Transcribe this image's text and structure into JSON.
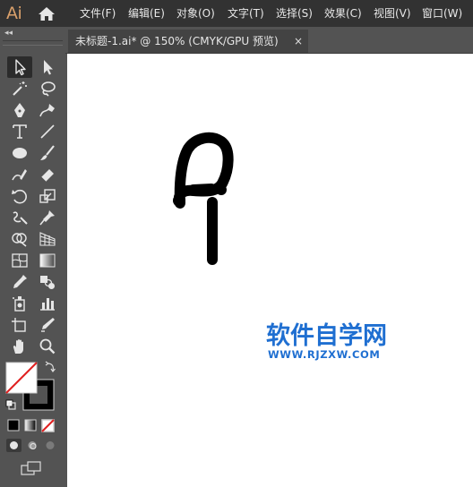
{
  "app": {
    "logo_text": "Ai"
  },
  "menu": {
    "items": [
      {
        "id": "file",
        "label": "文件(F)"
      },
      {
        "id": "edit",
        "label": "编辑(E)"
      },
      {
        "id": "object",
        "label": "对象(O)"
      },
      {
        "id": "type",
        "label": "文字(T)"
      },
      {
        "id": "select",
        "label": "选择(S)"
      },
      {
        "id": "effect",
        "label": "效果(C)"
      },
      {
        "id": "view",
        "label": "视图(V)"
      },
      {
        "id": "window",
        "label": "窗口(W)"
      }
    ]
  },
  "tools_panel": {
    "collapse_glyph": "◂◂"
  },
  "document": {
    "tab_title": "未标题-1.ai* @ 150% (CMYK/GPU 预览)",
    "close_glyph": "×",
    "zoom_percent": 150,
    "color_mode": "CMYK/GPU 预览"
  },
  "watermark": {
    "title": "软件自学网",
    "url": "WWW.RJZXW.COM"
  },
  "colors": {
    "accent_logo": "#d9a06b",
    "watermark_blue": "#1f6fd1",
    "menubar_bg": "#323232",
    "panel_bg": "#535353",
    "canvas_bg": "#ffffff",
    "stroke_color": "#000000",
    "none_swatch_red": "#e02020"
  },
  "icons": {
    "home": "home-icon",
    "tools": [
      "selection-tool-icon",
      "direct-selection-tool-icon",
      "magic-wand-tool-icon",
      "lasso-tool-icon",
      "pen-tool-icon",
      "curvature-tool-icon",
      "type-tool-icon",
      "line-segment-tool-icon",
      "ellipse-tool-icon",
      "paintbrush-tool-icon",
      "shaper-tool-icon",
      "eraser-tool-icon",
      "rotate-tool-icon",
      "scale-tool-icon",
      "warp-tool-icon",
      "puppet-warp-tool-icon",
      "shape-builder-tool-icon",
      "perspective-grid-tool-icon",
      "mesh-tool-icon",
      "gradient-tool-icon",
      "eyedropper-tool-icon",
      "blend-tool-icon",
      "symbol-sprayer-tool-icon",
      "column-graph-tool-icon",
      "artboard-tool-icon",
      "slice-tool-icon",
      "hand-tool-icon",
      "zoom-tool-icon"
    ]
  }
}
